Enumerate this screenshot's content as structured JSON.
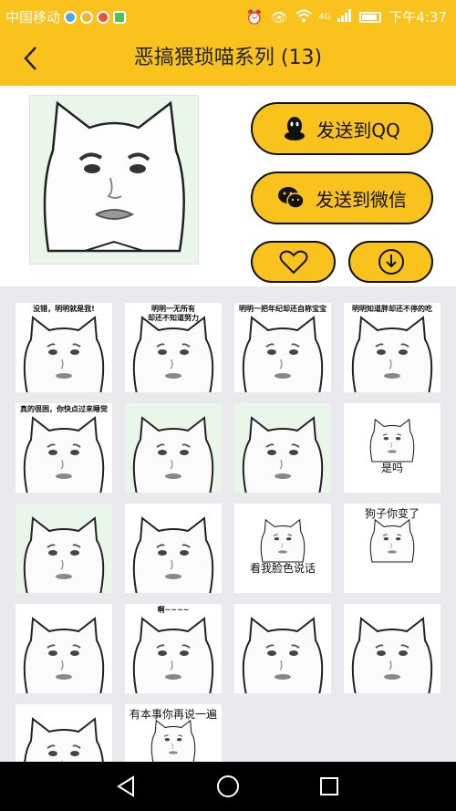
{
  "status_bar": {
    "carrier": "中国移动",
    "network": "4G",
    "time": "下午4:37",
    "app_icon_colors": [
      "#4aa8e8",
      "#f2b233",
      "#e8503a",
      "#4cc35a"
    ]
  },
  "header": {
    "title": "恶搞猥琐喵系列 (13)"
  },
  "actions": {
    "qq_label": "发送到QQ",
    "wechat_label": "发送到微信"
  },
  "stickers": [
    {
      "caption": "没错，明明就是我!",
      "bg": "#ffffff"
    },
    {
      "caption": "明明一无所有\n却还不知道努力",
      "bg": "#ffffff"
    },
    {
      "caption": "明明一把年纪却还自称宝宝",
      "bg": "#ffffff"
    },
    {
      "caption": "明明知道胖却还不停的吃",
      "bg": "#ffffff"
    },
    {
      "caption": "真的很困，你快点过来睡觉",
      "bg": "#ffffff"
    },
    {
      "caption": "",
      "bg": "#eaf6ea"
    },
    {
      "caption": "",
      "bg": "#eaf6ea"
    },
    {
      "caption": "是吗",
      "bg": "#ffffff"
    },
    {
      "caption": "",
      "bg": "#eaf6ea"
    },
    {
      "caption": "",
      "bg": "#ffffff"
    },
    {
      "caption": "看我脸色说话",
      "bg": "#ffffff"
    },
    {
      "caption": "狗子你变了",
      "bg": "#ffffff"
    },
    {
      "caption": "",
      "bg": "#ffffff"
    },
    {
      "caption": "啊~~~~",
      "bg": "#ffffff"
    },
    {
      "caption": "",
      "bg": "#ffffff"
    },
    {
      "caption": "",
      "bg": "#ffffff"
    },
    {
      "caption": "",
      "bg": "#ffffff"
    },
    {
      "caption": "有本事你再说一遍",
      "bg": "#ffffff"
    }
  ],
  "colors": {
    "accent": "#f9c21d",
    "grid_bg": "#e9e9ee",
    "nav_bg": "#000000"
  }
}
